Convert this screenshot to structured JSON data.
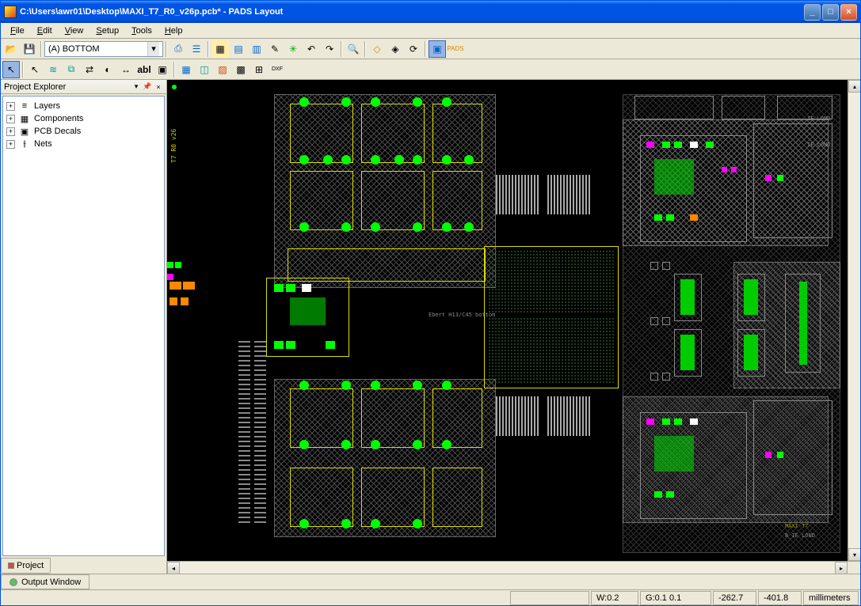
{
  "title": "C:\\Users\\awr01\\Desktop\\MAXI_T7_R0_v26p.pcb* - PADS Layout",
  "menu": {
    "file": "File",
    "edit": "Edit",
    "view": "View",
    "setup": "Setup",
    "tools": "Tools",
    "help": "Help"
  },
  "layer_combo": "(A) BOTTOM",
  "sidebar": {
    "title": "Project Explorer",
    "items": [
      {
        "label": "Layers"
      },
      {
        "label": "Components"
      },
      {
        "label": "PCB Decals"
      },
      {
        "label": "Nets"
      }
    ]
  },
  "sidebar_tab": "Project",
  "output_tab": "Output Window",
  "status": {
    "w": "W:0.2",
    "g": "G:0.1 0.1",
    "x": "-262.7",
    "y": "-401.8",
    "units": "millimeters"
  },
  "pcb_labels": {
    "center": "Ebert H13/C45 bottom"
  },
  "chart_data": null
}
